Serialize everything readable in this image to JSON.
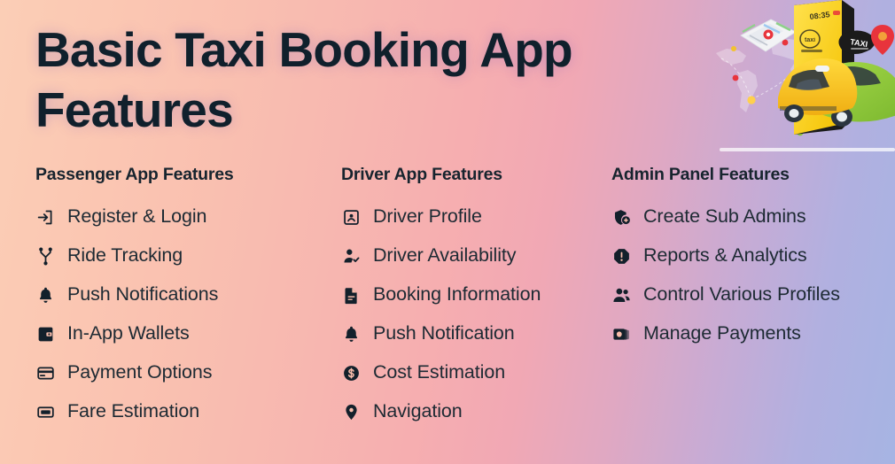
{
  "title": "Basic Taxi Booking App Features",
  "colors": {
    "gradient_left": "#fbceb6",
    "gradient_mid": "#f6aeb0",
    "gradient_right": "#a6b4e3",
    "heading_text": "#17242e",
    "body_text": "#1d2a33",
    "title_text": "#10202c",
    "divider": "#ffffff",
    "taxi_yellow": "#f5c518",
    "car_green": "#8cc63f",
    "pin_red": "#e8343c"
  },
  "illustration": {
    "name": "isometric-taxi-booking-illustration",
    "phone_time": "08:35",
    "taxi_sign_label": "TAXI",
    "badge_label": "taxi",
    "elements": [
      "map-card",
      "world-map",
      "phone",
      "taxi-car",
      "location-pin"
    ]
  },
  "columns": [
    {
      "heading": "Passenger App Features",
      "items": [
        {
          "icon": "login-arrow-icon",
          "label": "Register & Login"
        },
        {
          "icon": "route-fork-icon",
          "label": "Ride Tracking"
        },
        {
          "icon": "bell-icon",
          "label": "Push Notifications"
        },
        {
          "icon": "wallet-icon",
          "label": "In-App Wallets"
        },
        {
          "icon": "credit-card-icon",
          "label": "Payment Options"
        },
        {
          "icon": "fare-meter-icon",
          "label": "Fare Estimation"
        }
      ]
    },
    {
      "heading": "Driver App Features",
      "items": [
        {
          "icon": "id-card-icon",
          "label": "Driver Profile"
        },
        {
          "icon": "person-check-icon",
          "label": "Driver Availability"
        },
        {
          "icon": "document-icon",
          "label": "Booking Information"
        },
        {
          "icon": "bell-icon",
          "label": "Push Notification"
        },
        {
          "icon": "dollar-circle-icon",
          "label": "Cost Estimation"
        },
        {
          "icon": "map-pin-icon",
          "label": "Navigation"
        }
      ]
    },
    {
      "heading": "Admin Panel Features",
      "items": [
        {
          "icon": "shield-add-user-icon",
          "label": "Create Sub Admins"
        },
        {
          "icon": "alert-octagon-icon",
          "label": "Reports & Analytics"
        },
        {
          "icon": "people-group-icon",
          "label": "Control Various Profiles"
        },
        {
          "icon": "money-stack-icon",
          "label": "Manage Payments"
        }
      ]
    }
  ]
}
